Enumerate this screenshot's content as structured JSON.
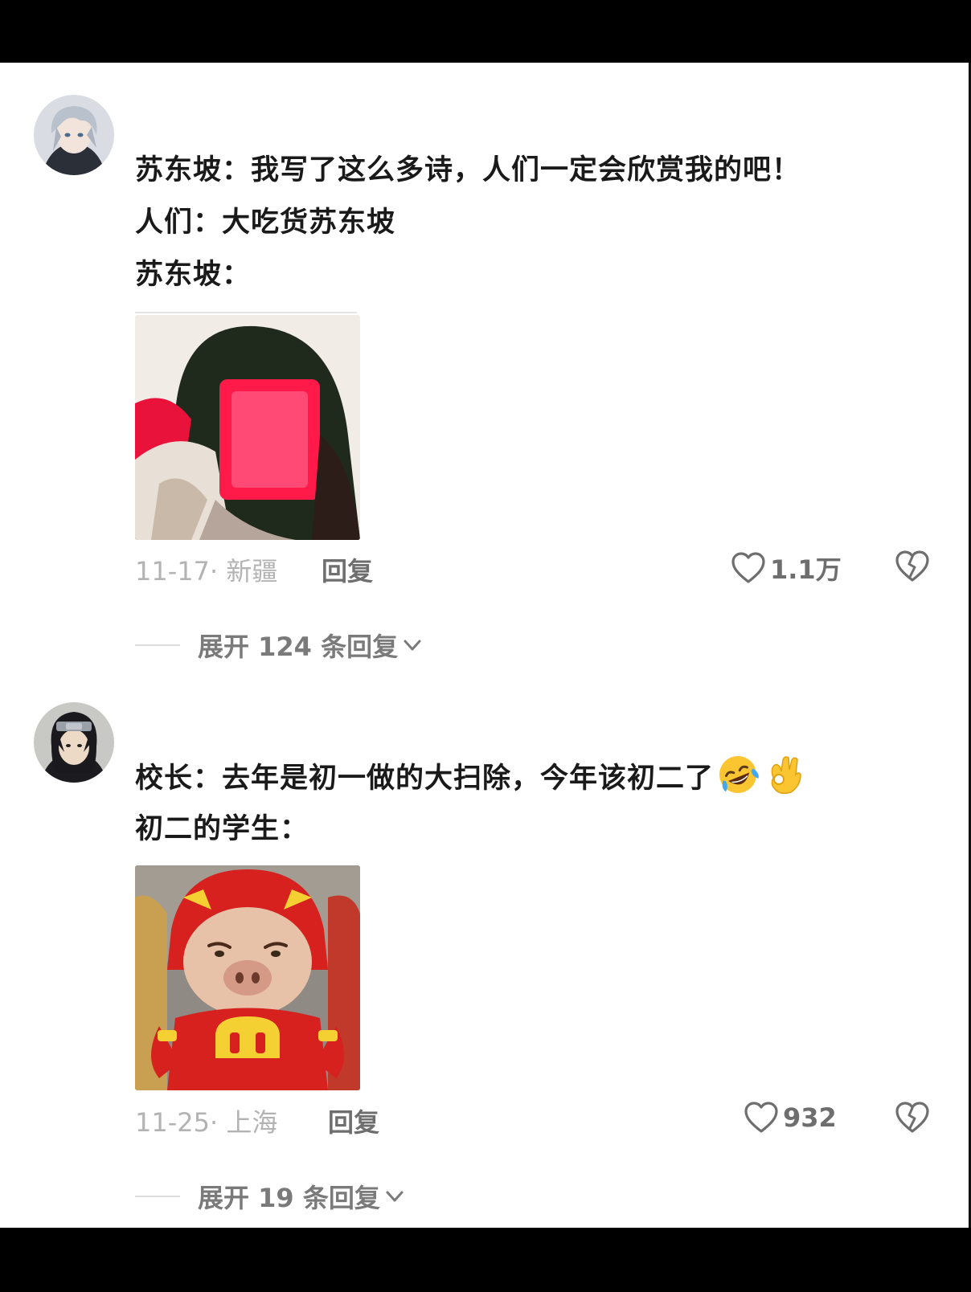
{
  "comments": [
    {
      "lines": [
        "苏东坡：我写了这么多诗，人们一定会欣赏我的吧！",
        "人们：大吃货苏东坡",
        "苏东坡："
      ],
      "meta": "11-17· 新疆",
      "reply_label": "回复",
      "likes": "1.1万",
      "expand_label": "展开 124 条回复"
    },
    {
      "lines": [
        "校长：去年是初一做的大扫除，今年该初二了",
        "初二的学生："
      ],
      "emoji": [
        "rolling-laughing-emoji",
        "ok-hand-emoji"
      ],
      "meta": "11-25· 上海",
      "reply_label": "回复",
      "likes": "932",
      "expand_label": "展开 19 条回复"
    }
  ],
  "colors": {
    "text": "#1a1a1a",
    "meta": "#b3b3b3",
    "action": "#6e6e6e"
  }
}
